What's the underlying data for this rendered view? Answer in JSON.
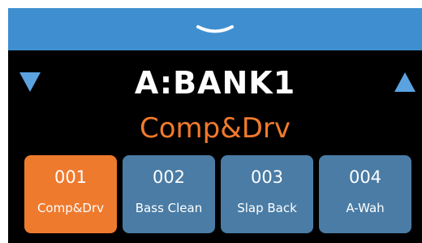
{
  "colors": {
    "top_bar": "#3f8fd0",
    "background": "#000000",
    "accent_orange": "#ee7a2e",
    "patch_orange_text": "#f07a2c",
    "patch_blue": "#4a7ca5",
    "arrow_blue": "#5aa3e0"
  },
  "icons": {
    "collapse": "chevron-down-icon",
    "prev_bank": "triangle-down-icon",
    "next_bank": "triangle-up-icon"
  },
  "bank": {
    "name": "A:BANK1"
  },
  "current_patch": {
    "name": "Comp&Drv"
  },
  "patches": [
    {
      "number": "001",
      "label": "Comp&Drv",
      "selected": true
    },
    {
      "number": "002",
      "label": "Bass Clean",
      "selected": false
    },
    {
      "number": "003",
      "label": "Slap Back",
      "selected": false
    },
    {
      "number": "004",
      "label": "A-Wah",
      "selected": false
    }
  ]
}
